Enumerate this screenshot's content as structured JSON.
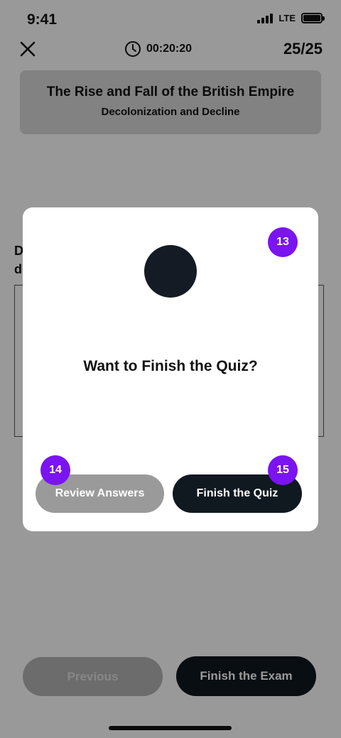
{
  "status_bar": {
    "time": "9:41",
    "network": "LTE"
  },
  "header": {
    "timer": "00:20:20",
    "progress": "25/25"
  },
  "topic": {
    "title": "The Rise and Fall of the British Empire",
    "subtitle": "Decolonization and Decline"
  },
  "question": {
    "visible_text": "D\nd"
  },
  "bottom_nav": {
    "previous_label": "Previous",
    "finish_exam_label": "Finish the Exam"
  },
  "modal": {
    "title": "Want to Finish the Quiz?",
    "review_label": "Review Answers",
    "finish_label": "Finish the Quiz"
  },
  "badges": {
    "modal": "13",
    "review": "14",
    "finish": "15"
  },
  "colors": {
    "accent_badge": "#7a14f0",
    "dark_button": "#101820"
  }
}
